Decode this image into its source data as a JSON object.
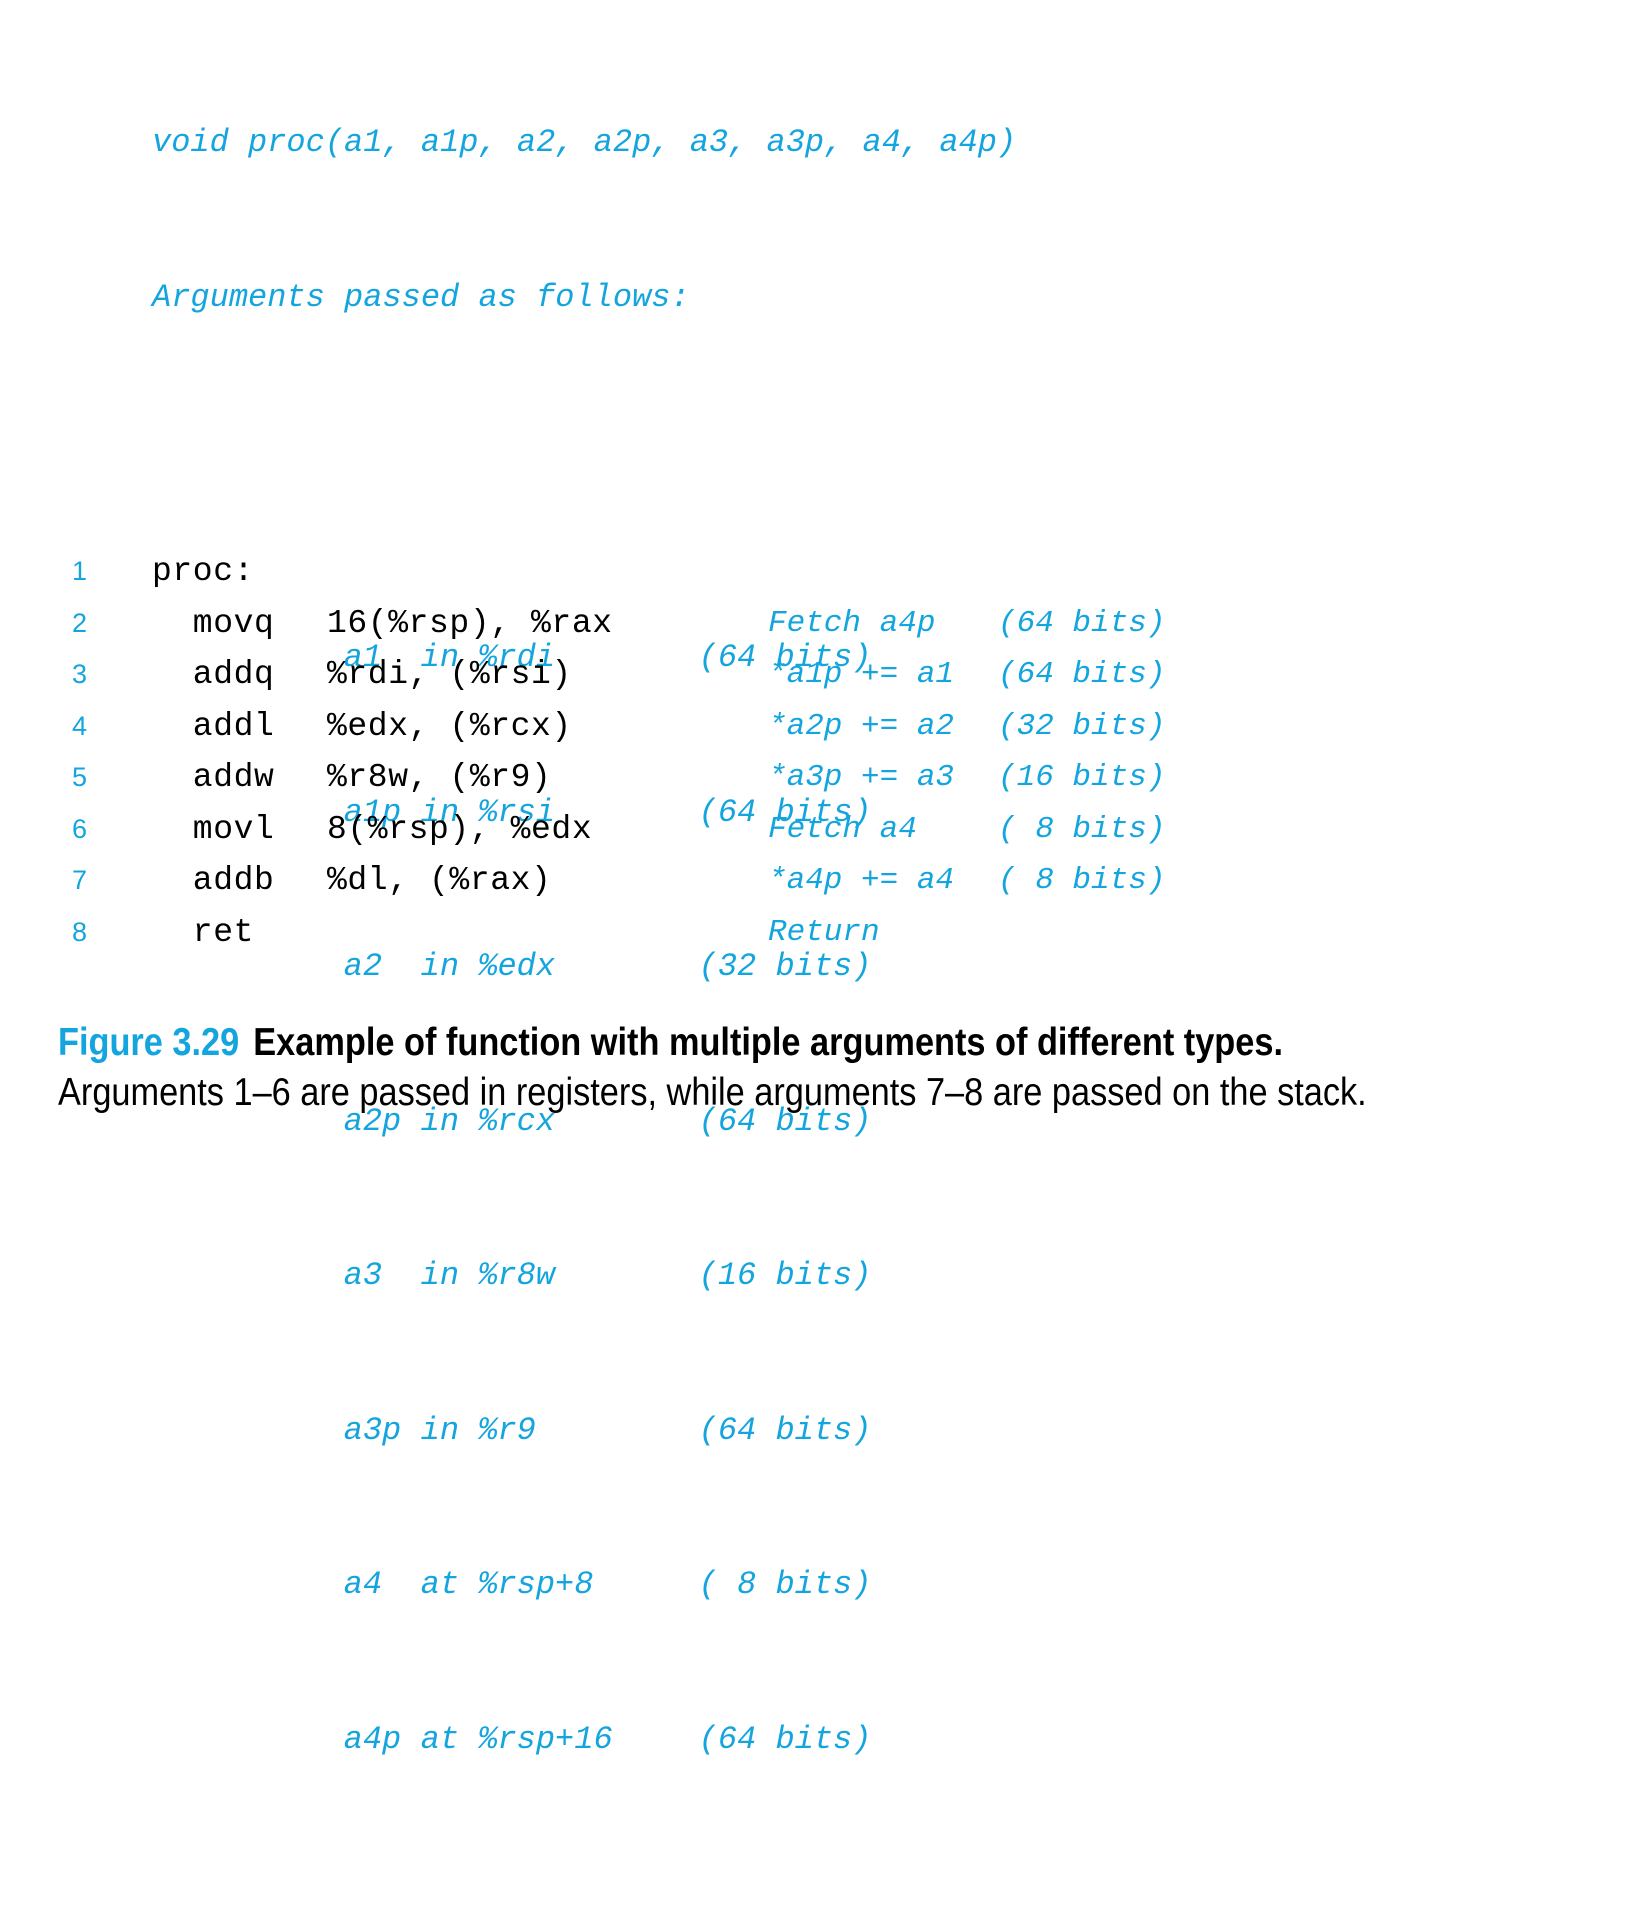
{
  "preamble": {
    "signature": "void proc(a1, a1p, a2, a2p, a3, a3p, a4, a4p)",
    "intro": "Arguments passed as follows:",
    "arguments": [
      {
        "name": "a1",
        "location": "in %rdi",
        "bits": "(64 bits)"
      },
      {
        "name": "a1p",
        "location": "in %rsi",
        "bits": "(64 bits)"
      },
      {
        "name": "a2",
        "location": "in %edx",
        "bits": "(32 bits)"
      },
      {
        "name": "a2p",
        "location": "in %rcx",
        "bits": "(64 bits)"
      },
      {
        "name": "a3",
        "location": "in %r8w",
        "bits": "(16 bits)"
      },
      {
        "name": "a3p",
        "location": "in %r9",
        "bits": "(64 bits)"
      },
      {
        "name": "a4",
        "location": "at %rsp+8",
        "bits": "( 8 bits)"
      },
      {
        "name": "a4p",
        "location": "at %rsp+16",
        "bits": "(64 bits)"
      }
    ]
  },
  "code": {
    "lines": [
      {
        "number": "1",
        "op": "proc:",
        "operands": "",
        "comment": "",
        "bits": ""
      },
      {
        "number": "2",
        "op": "  movq",
        "operands": "16(%rsp), %rax",
        "comment": "Fetch a4p",
        "bits": "(64 bits)"
      },
      {
        "number": "3",
        "op": "  addq",
        "operands": "%rdi, (%rsi)",
        "comment": "*a1p += a1",
        "bits": "(64 bits)"
      },
      {
        "number": "4",
        "op": "  addl",
        "operands": "%edx, (%rcx)",
        "comment": "*a2p += a2",
        "bits": "(32 bits)"
      },
      {
        "number": "5",
        "op": "  addw",
        "operands": "%r8w, (%r9)",
        "comment": "*a3p += a3",
        "bits": "(16 bits)"
      },
      {
        "number": "6",
        "op": "  movl",
        "operands": "8(%rsp), %edx",
        "comment": "Fetch a4",
        "bits": "( 8 bits)"
      },
      {
        "number": "7",
        "op": "  addb",
        "operands": "%dl, (%rax)",
        "comment": "*a4p += a4",
        "bits": "( 8 bits)"
      },
      {
        "number": "8",
        "op": "  ret",
        "operands": "",
        "comment": "Return",
        "bits": ""
      }
    ]
  },
  "caption": {
    "figure_label": "Figure 3.29",
    "title": "Example of function with multiple arguments of different types.",
    "description": "Arguments 1–6 are passed in registers, while arguments 7–8 are passed on the stack."
  },
  "colors": {
    "accent_blue": "#15a5de",
    "code_black": "#000000",
    "background": "#ffffff"
  }
}
